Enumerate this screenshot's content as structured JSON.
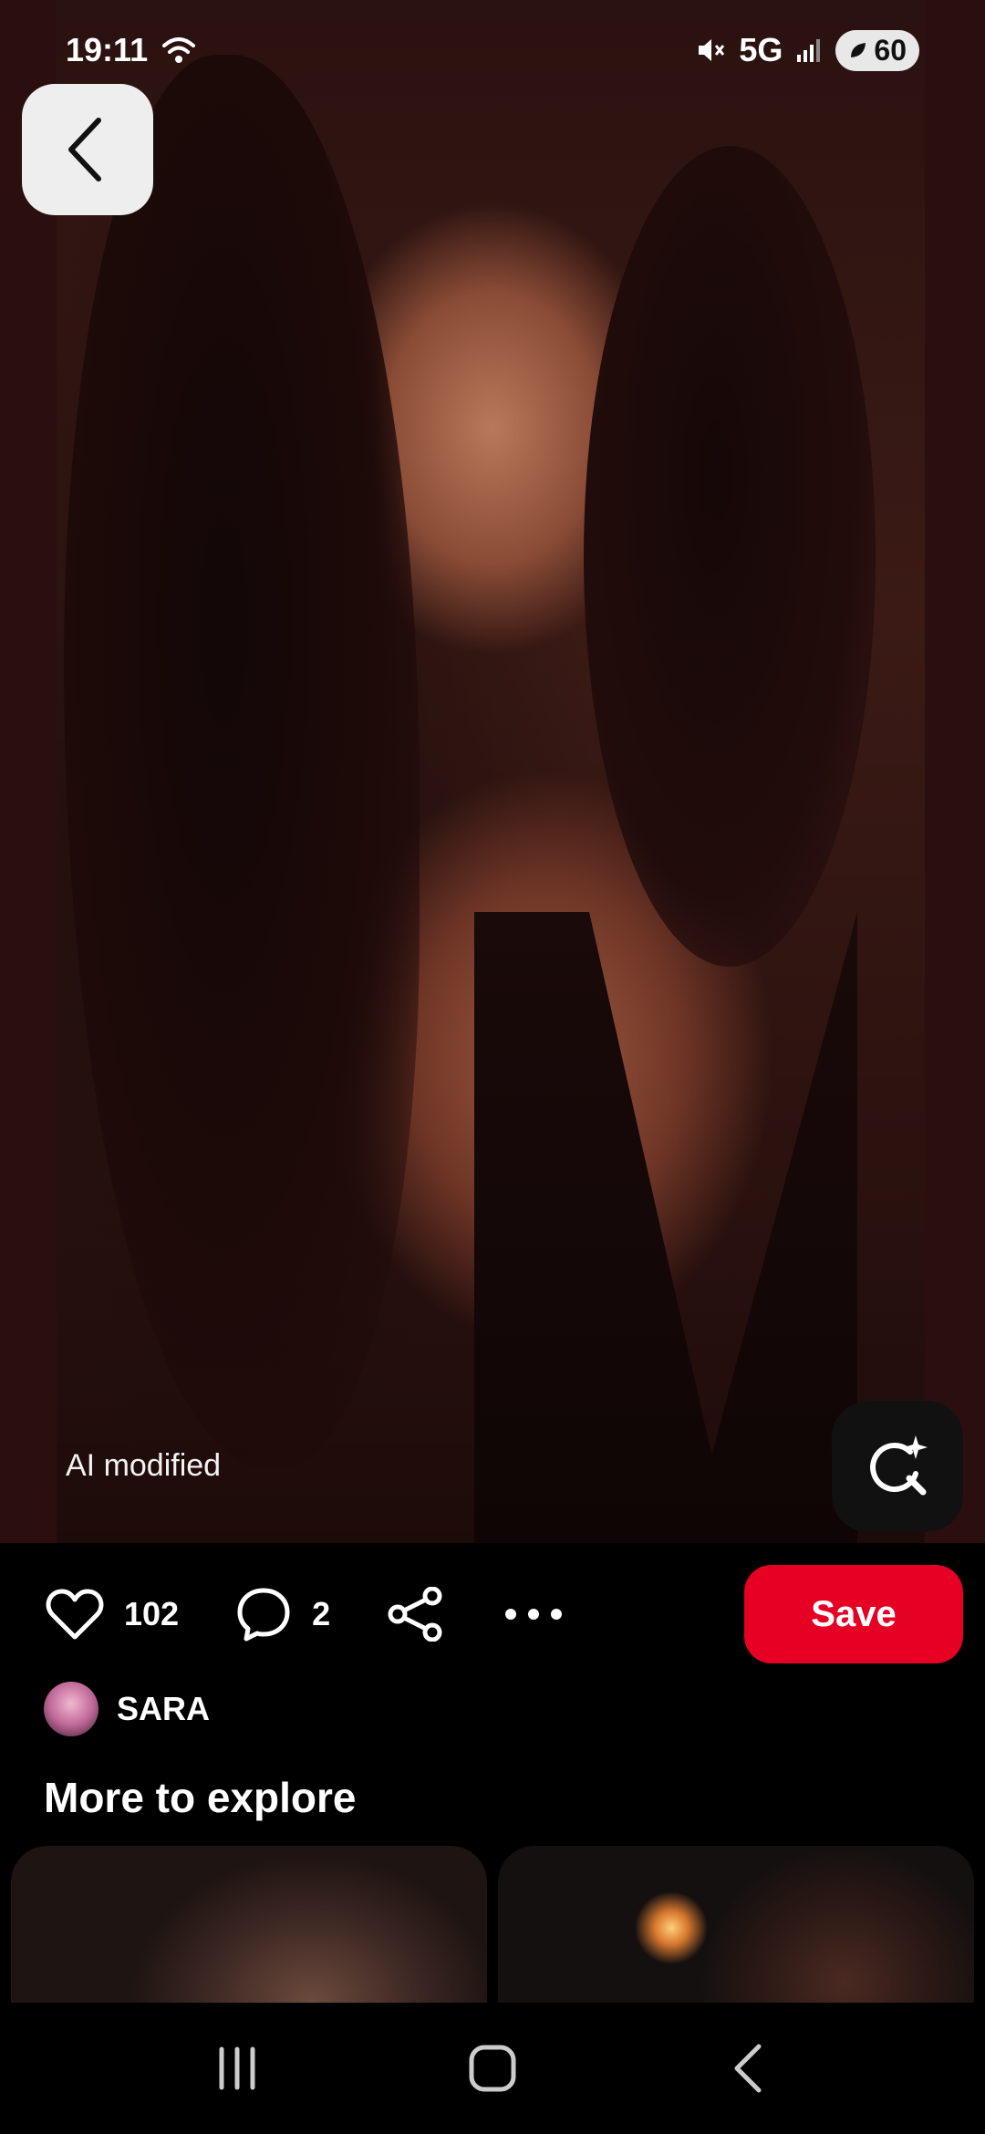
{
  "status_bar": {
    "time": "19:11",
    "network": "5G",
    "battery": "60",
    "icons": [
      "wifi-icon",
      "mute-icon",
      "signal-icon",
      "battery-saver-icon"
    ]
  },
  "pin": {
    "ai_label": "AI modified",
    "likes": "102",
    "comments": "2",
    "save_label": "Save",
    "author": "SARA"
  },
  "explore": {
    "title": "More to explore",
    "thumbnails": 2
  },
  "colors": {
    "save_button": "#e60023",
    "background": "#000000",
    "back_button": "#eeeeee"
  }
}
